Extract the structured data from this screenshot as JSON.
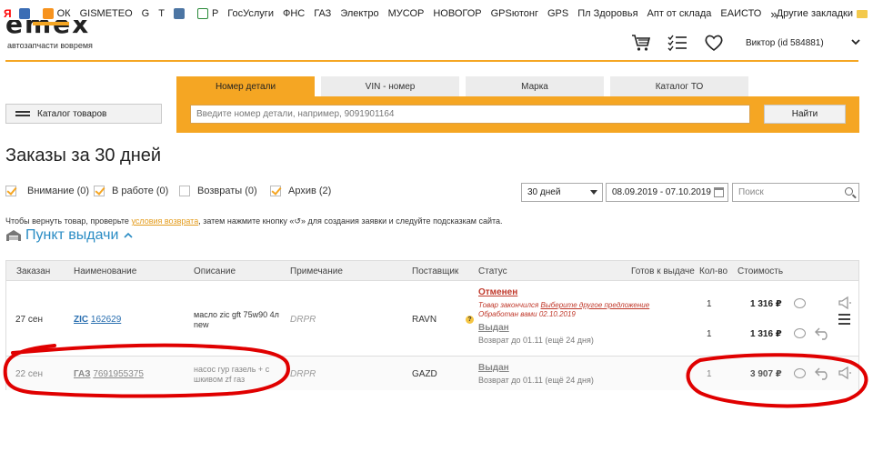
{
  "bookmarks": {
    "yandex": "Я",
    "items": [
      "ОК",
      "GISMETEO",
      "G",
      "Т",
      "Р",
      "ГосУслуги",
      "ФНС",
      "ГАЗ",
      "Электро",
      "МУСОР",
      "НОВОГОР",
      "GPSютонг",
      "GPS",
      "Пл Здоровья",
      "Апт от склада",
      "ЕАИСТО"
    ],
    "overflow": "»",
    "other": "Другие закладки"
  },
  "header": {
    "logo": "emex",
    "tagline": "автозапчасти вовремя",
    "user": "Виктор  (id 584881)"
  },
  "search": {
    "tabs": [
      "Номер детали",
      "VIN - номер",
      "Марка",
      "Каталог ТО"
    ],
    "placeholder": "Введите номер детали, например, 9091901164",
    "button": "Найти"
  },
  "catalog_button": "Каталог товаров",
  "page_title": "Заказы за 30 дней",
  "filters": [
    {
      "label": "Внимание (0)",
      "checked": true
    },
    {
      "label": "В работе (0)",
      "checked": true
    },
    {
      "label": "Возвраты (0)",
      "checked": false
    },
    {
      "label": "Архив (2)",
      "checked": true
    }
  ],
  "period": "30 дней",
  "date_range": "08.09.2019 - 07.10.2019",
  "search_placeholder": "Поиск",
  "hint": {
    "before": "Чтобы вернуть товар, проверьте ",
    "link": "условия возврата",
    "after": ", затем нажмите кнопку «↺» для создания заявки и следуйте подсказкам сайта."
  },
  "pickup": "Пункт выдачи",
  "table": {
    "headers": [
      "Заказан",
      "Наименование",
      "Описание",
      "Примечание",
      "Поставщик",
      "Статус",
      "Готов к выдаче",
      "Кол-во",
      "Стоимость"
    ],
    "rows": [
      {
        "date": "27 сен",
        "brand": "ZIC",
        "code": "162629",
        "description": "масло zic gft 75w90 4л new",
        "note": "DRPR",
        "supplier": "RAVN",
        "status1": "Отменен",
        "status1_reason": "Товар закончился",
        "status1_link": "Выберите другое предложение",
        "status1_processed": "Обработан вами 02.10.2019",
        "qty1": "1",
        "price1": "1 316 ₽",
        "status2": "Выдан",
        "status2_note": "Возврат до 01.11 (ещё 24 дня)",
        "qty2": "1",
        "price2": "1 316 ₽"
      },
      {
        "date": "22 сен",
        "brand": "ГАЗ",
        "code": "7691955375",
        "description": "насос гур газель + с шкивом zf газ",
        "note": "DRPR",
        "supplier": "GAZD",
        "status": "Выдан",
        "status_note": "Возврат до 01.11 (ещё 24 дня)",
        "qty": "1",
        "price": "3 907 ₽"
      }
    ]
  },
  "colors": {
    "accent": "#f5a623",
    "link": "#2a8cc4",
    "annotation": "#e00000"
  }
}
